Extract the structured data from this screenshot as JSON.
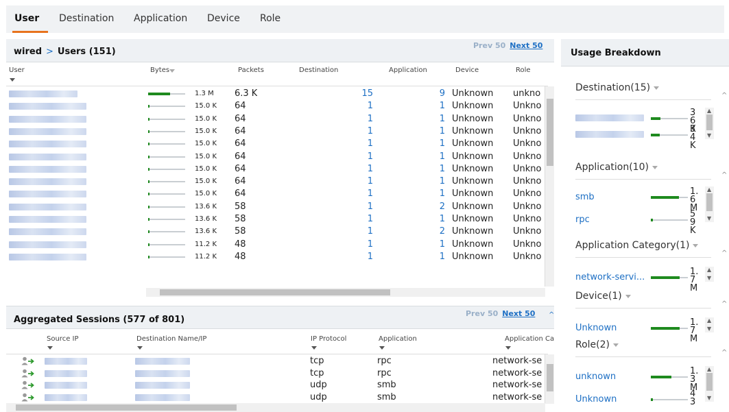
{
  "tabs": [
    {
      "label": "User"
    },
    {
      "label": "Destination"
    },
    {
      "label": "Application"
    },
    {
      "label": "Device"
    },
    {
      "label": "Role"
    }
  ],
  "users_panel": {
    "crumb": "wired",
    "separator": ">",
    "title": "Users (151)",
    "prev": "Prev 50",
    "next": "Next 50",
    "columns": [
      "User",
      "Bytes",
      "Packets",
      "Destination",
      "Application",
      "Device",
      "Role"
    ],
    "rows": [
      {
        "bytes": "1.3 M",
        "bytes_pct": 0.6,
        "packets": "6.3 K",
        "destination": "15",
        "application": "9",
        "device": "Unknown",
        "role": "unkno"
      },
      {
        "bytes": "15.0 K",
        "bytes_pct": 0.02,
        "packets": "64",
        "destination": "1",
        "application": "1",
        "device": "Unknown",
        "role": "Unkno"
      },
      {
        "bytes": "15.0 K",
        "bytes_pct": 0.02,
        "packets": "64",
        "destination": "1",
        "application": "1",
        "device": "Unknown",
        "role": "Unkno"
      },
      {
        "bytes": "15.0 K",
        "bytes_pct": 0.02,
        "packets": "64",
        "destination": "1",
        "application": "1",
        "device": "Unknown",
        "role": "Unkno"
      },
      {
        "bytes": "15.0 K",
        "bytes_pct": 0.02,
        "packets": "64",
        "destination": "1",
        "application": "1",
        "device": "Unknown",
        "role": "Unkno"
      },
      {
        "bytes": "15.0 K",
        "bytes_pct": 0.02,
        "packets": "64",
        "destination": "1",
        "application": "1",
        "device": "Unknown",
        "role": "Unkno"
      },
      {
        "bytes": "15.0 K",
        "bytes_pct": 0.02,
        "packets": "64",
        "destination": "1",
        "application": "1",
        "device": "Unknown",
        "role": "Unkno"
      },
      {
        "bytes": "15.0 K",
        "bytes_pct": 0.02,
        "packets": "64",
        "destination": "1",
        "application": "1",
        "device": "Unknown",
        "role": "Unkno"
      },
      {
        "bytes": "15.0 K",
        "bytes_pct": 0.02,
        "packets": "64",
        "destination": "1",
        "application": "1",
        "device": "Unknown",
        "role": "Unkno"
      },
      {
        "bytes": "13.6 K",
        "bytes_pct": 0.02,
        "packets": "58",
        "destination": "1",
        "application": "2",
        "device": "Unknown",
        "role": "Unkno"
      },
      {
        "bytes": "13.6 K",
        "bytes_pct": 0.02,
        "packets": "58",
        "destination": "1",
        "application": "1",
        "device": "Unknown",
        "role": "Unkno"
      },
      {
        "bytes": "13.6 K",
        "bytes_pct": 0.02,
        "packets": "58",
        "destination": "1",
        "application": "2",
        "device": "Unknown",
        "role": "Unkno"
      },
      {
        "bytes": "11.2 K",
        "bytes_pct": 0.02,
        "packets": "48",
        "destination": "1",
        "application": "1",
        "device": "Unknown",
        "role": "Unkno"
      },
      {
        "bytes": "11.2 K",
        "bytes_pct": 0.02,
        "packets": "48",
        "destination": "1",
        "application": "1",
        "device": "Unknown",
        "role": "Unkno"
      }
    ]
  },
  "sessions_panel": {
    "title": "Aggregated Sessions (577 of 801)",
    "prev": "Prev 50",
    "next": "Next 50",
    "columns": [
      "Source IP",
      "Destination Name/IP",
      "IP Protocol",
      "Application",
      "Application Categ"
    ],
    "rows": [
      {
        "protocol": "tcp",
        "application": "rpc",
        "category": "network-se"
      },
      {
        "protocol": "tcp",
        "application": "rpc",
        "category": "network-se"
      },
      {
        "protocol": "udp",
        "application": "smb",
        "category": "network-se"
      },
      {
        "protocol": "udp",
        "application": "smb",
        "category": "network-se"
      }
    ]
  },
  "usage": {
    "title": "Usage Breakdown",
    "sections": [
      {
        "title": "Destination(15)",
        "rows": [
          {
            "label": "",
            "value": "36 K",
            "pct": 0.25
          },
          {
            "label": "",
            "value": "34 K",
            "pct": 0.24
          }
        ]
      },
      {
        "title": "Application(10)",
        "rows": [
          {
            "label": "smb",
            "value": "1.6 M",
            "pct": 0.75
          },
          {
            "label": "rpc",
            "value": "59 K",
            "pct": 0.05
          }
        ]
      },
      {
        "title": "Application Category(1)",
        "rows": [
          {
            "label": "network-servi...",
            "value": "1.7 M",
            "pct": 0.78
          }
        ]
      },
      {
        "title": "Device(1)",
        "rows": [
          {
            "label": "Unknown",
            "value": "1.7 M",
            "pct": 0.78
          }
        ]
      },
      {
        "title": "Role(2)",
        "rows": [
          {
            "label": "unknown",
            "value": "1.3 M",
            "pct": 0.55
          },
          {
            "label": "Unknown",
            "value": "43",
            "pct": 0.05
          }
        ]
      }
    ]
  }
}
